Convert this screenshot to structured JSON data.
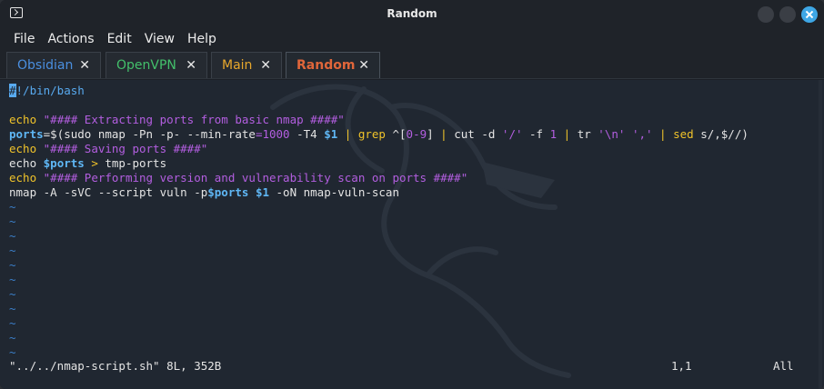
{
  "window": {
    "title": "Random"
  },
  "menu": [
    "File",
    "Actions",
    "Edit",
    "View",
    "Help"
  ],
  "tabs": [
    {
      "label": "Obsidian",
      "color": "#4a8fe0"
    },
    {
      "label": "OpenVPN",
      "color": "#43c06b"
    },
    {
      "label": "Main",
      "color": "#e8a82c"
    },
    {
      "label": "Random",
      "color": "#e0663a"
    }
  ],
  "tab_close_glyph": "✕",
  "editor": {
    "shebang_hash": "#",
    "shebang_rest": "!/bin/bash",
    "l1": {
      "cmd": "echo",
      "str": "\"#### Extracting ports from basic nmap ####\""
    },
    "l2": {
      "var": "ports",
      "eq": "=$(sudo nmap -Pn -p- --min-rate",
      "eq2": "=",
      "n1000": "1000",
      "t4": " -T4 ",
      "arg1": "$1",
      "pipe1": " | ",
      "grep": "grep",
      "grep_a": " ^[",
      "range": "0-9",
      "grep_b": "]",
      "pipe2": " | ",
      "cut": "cut -d ",
      "cutd": "'/'",
      "cutf": " -f ",
      "n1": "1",
      "pipe3": " | ",
      "tr": "tr ",
      "tr1": "'\\n'",
      "sp": " ",
      "tr2": "','",
      "pipe4": " | ",
      "sed": "sed",
      "sedarg": " s/,$//)"
    },
    "l3": {
      "cmd": "echo",
      "str": "\"#### Saving ports ####\""
    },
    "l4": {
      "cmd": "echo ",
      "var": "$ports",
      "gt": " > ",
      "rest": "tmp-ports"
    },
    "l5": {
      "cmd": "echo",
      "str": "\"#### Performing version and vulnerability scan on ports ####\""
    },
    "l6": {
      "a": "nmap -A -sVC --script vuln -p",
      "var": "$ports",
      "sp": " ",
      "arg": "$1",
      "b": " -oN nmap-vuln-scan"
    },
    "tilde": "~",
    "status_file": "\"../../nmap-script.sh\" 8L, 352B",
    "status_pos": "1,1",
    "status_scroll": "All"
  }
}
